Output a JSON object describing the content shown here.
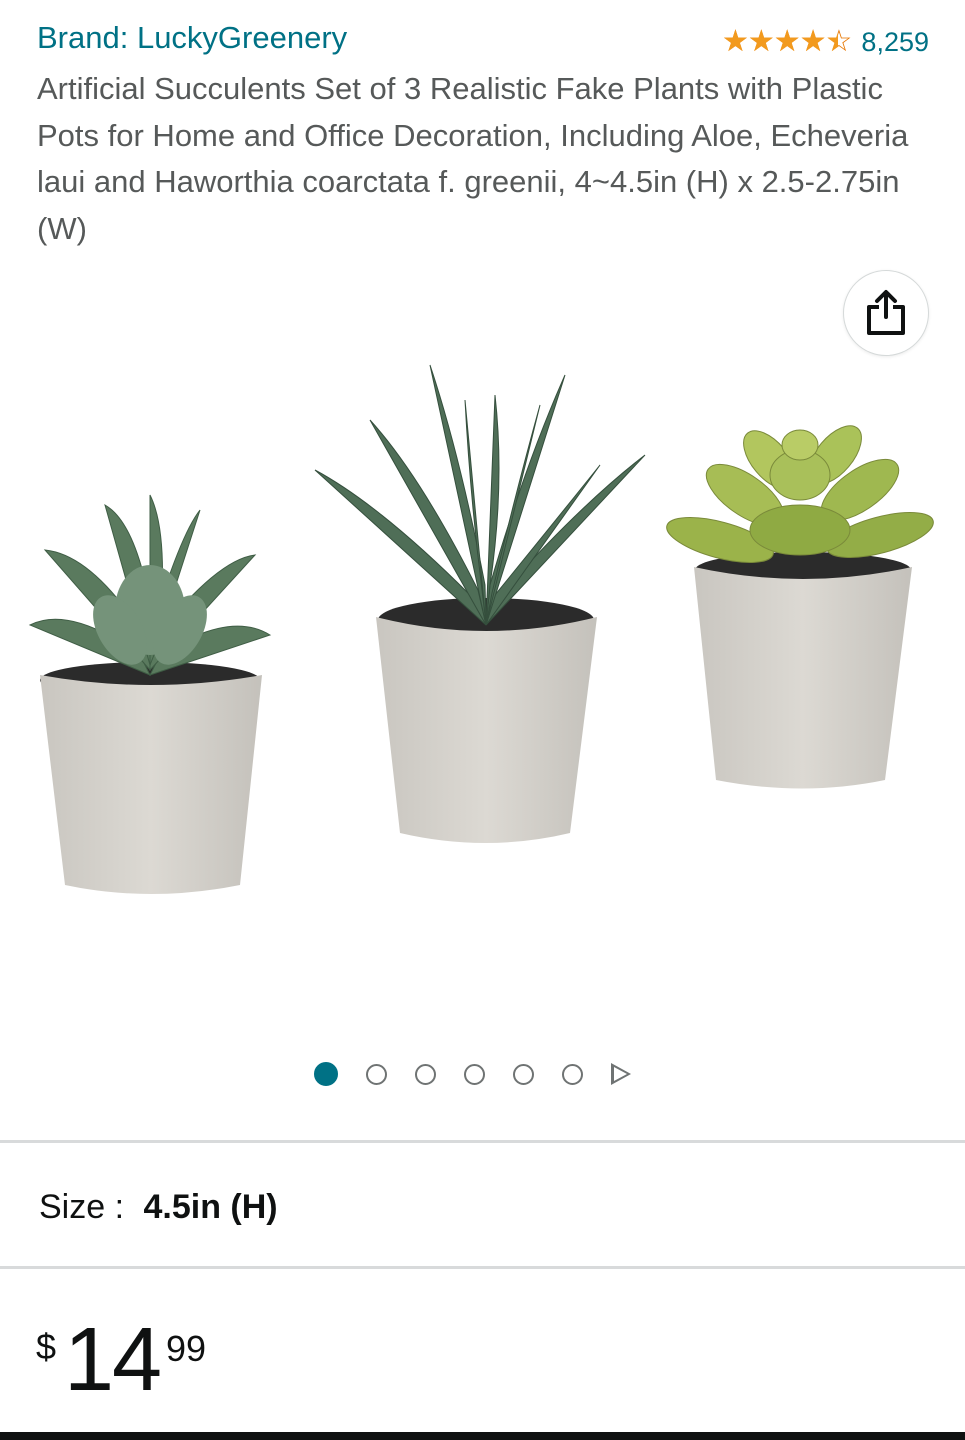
{
  "brand": {
    "label": "Brand: LuckyGreenery"
  },
  "rating": {
    "stars": 4.5,
    "max_stars": 5,
    "stars_glyphs": "★★★★★",
    "count": "8,259"
  },
  "product": {
    "title": "Artificial Succulents Set of 3 Realistic Fake Plants with Plastic Pots for Home and Office Decoration, Including Aloe, Echeveria laui and Haworthia coarctata f. greenii, 4~4.5in (H) x 2.5-2.75in (W)"
  },
  "gallery": {
    "image_count": 6,
    "active_index": 0,
    "share_icon": "share-icon"
  },
  "size": {
    "label": "Size :",
    "value": "4.5in (H)"
  },
  "price": {
    "symbol": "$",
    "whole": "14",
    "fraction": "99"
  },
  "colors": {
    "link": "#007185",
    "star": "#f29a1e",
    "text": "#0f1111",
    "muted": "#565959"
  }
}
